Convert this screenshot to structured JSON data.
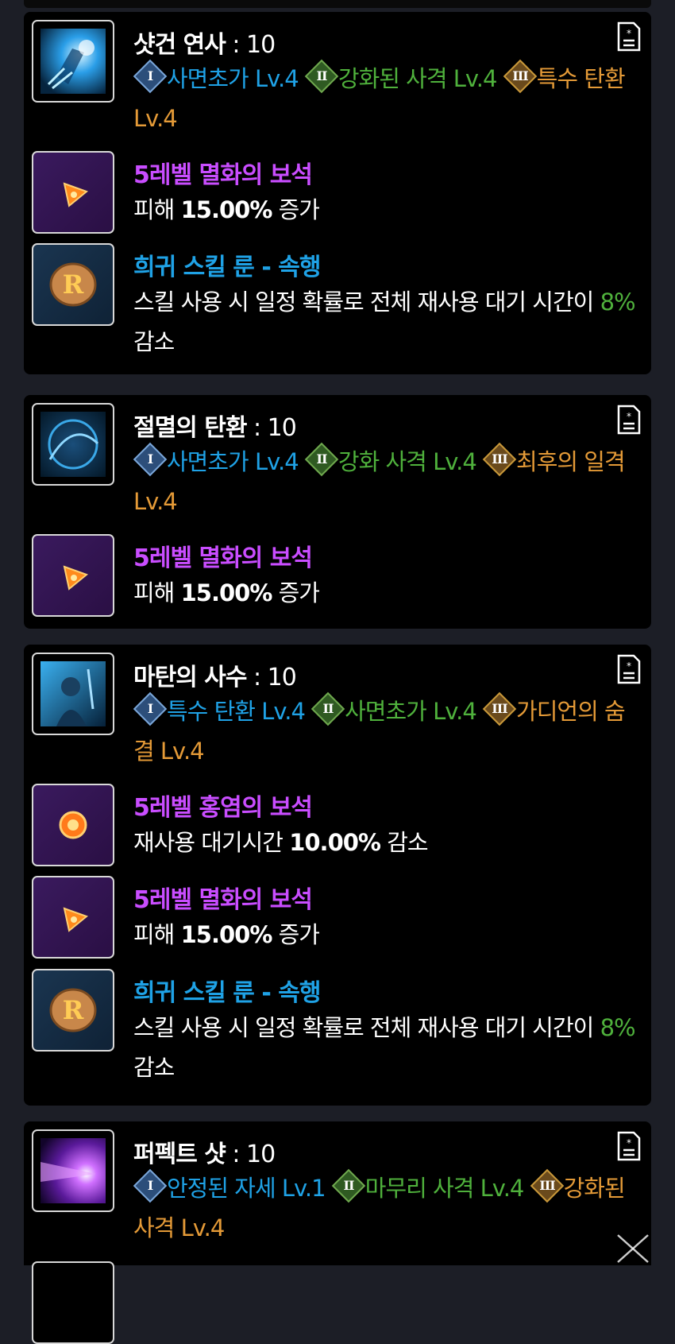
{
  "cards": [
    {
      "skill": {
        "name": "샷건 연사",
        "level": " : 10"
      },
      "tripods": [
        {
          "num": "I",
          "label": "사면초가 Lv.4"
        },
        {
          "num": "II",
          "label": "강화된 사격 Lv.4"
        },
        {
          "num": "III",
          "label": "특수 탄환 Lv.4"
        }
      ],
      "items": [
        {
          "name": "5레벨 멸화의 보석",
          "desc_pre": "피해 ",
          "desc_bold": "15.00%",
          "desc_post": " 증가"
        },
        {
          "name": "희귀 스킬 룬 - 속행",
          "desc_pre": "스킬 사용 시 일정 확률로 전체 재사용 대기 시간이 ",
          "desc_green": "8%",
          "desc_post": " 감소"
        }
      ]
    },
    {
      "skill": {
        "name": "절멸의 탄환",
        "level": " : 10"
      },
      "tripods": [
        {
          "num": "I",
          "label": "사면초가 Lv.4"
        },
        {
          "num": "II",
          "label": "강화 사격 Lv.4"
        },
        {
          "num": "III",
          "label": "최후의 일격 Lv.4"
        }
      ],
      "items": [
        {
          "name": "5레벨 멸화의 보석",
          "desc_pre": "피해 ",
          "desc_bold": "15.00%",
          "desc_post": " 증가"
        }
      ]
    },
    {
      "skill": {
        "name": "마탄의 사수",
        "level": " : 10"
      },
      "tripods": [
        {
          "num": "I",
          "label": "특수 탄환 Lv.4"
        },
        {
          "num": "II",
          "label": "사면초가 Lv.4"
        },
        {
          "num": "III",
          "label": "가디언의 숨결 Lv.4"
        }
      ],
      "items": [
        {
          "name": "5레벨 홍염의 보석",
          "desc_pre": "재사용 대기시간 ",
          "desc_bold": "10.00%",
          "desc_post": " 감소"
        },
        {
          "name": "5레벨 멸화의 보석",
          "desc_pre": "피해 ",
          "desc_bold": "15.00%",
          "desc_post": " 증가"
        },
        {
          "name": "희귀 스킬 룬 - 속행",
          "desc_pre": "스킬 사용 시 일정 확률로 전체 재사용 대기 시간이 ",
          "desc_green": "8%",
          "desc_post": " 감소"
        }
      ]
    },
    {
      "skill": {
        "name": "퍼펙트 샷",
        "level": " : 10"
      },
      "tripods": [
        {
          "num": "I",
          "label": "안정된 자세 Lv.1"
        },
        {
          "num": "II",
          "label": "마무리 사격 Lv.4"
        },
        {
          "num": "III",
          "label": "강화된 사격 Lv.4"
        }
      ]
    }
  ],
  "icons": {
    "skill_icons": [
      "shotgun-burst-skill-icon",
      "annihilation-bullet-skill-icon",
      "magic-bullet-marksman-skill-icon",
      "perfect-shot-skill-icon"
    ],
    "doc": "document-icon",
    "close": "close-icon"
  }
}
